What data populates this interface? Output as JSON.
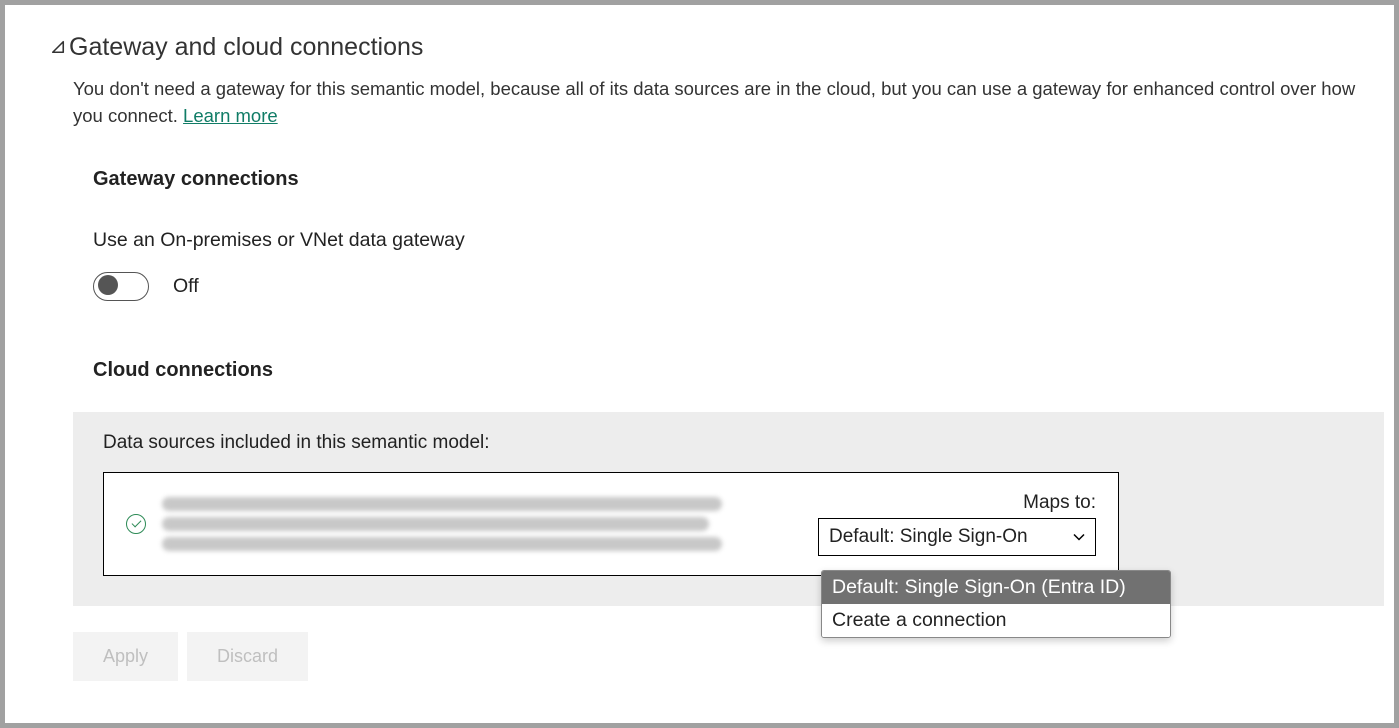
{
  "section": {
    "title": "Gateway and cloud connections",
    "description_pre": "You don't need a gateway for this semantic model, because all of its data sources are in the cloud, but you can use a gateway for enhanced control over how you connect. ",
    "learn_more": "Learn more"
  },
  "gateway": {
    "title": "Gateway connections",
    "toggle_label": "Use an On-premises or VNet data gateway",
    "toggle_state": "Off"
  },
  "cloud": {
    "title": "Cloud connections",
    "data_sources_label": "Data sources included in this semantic model:",
    "maps_to_label": "Maps to:",
    "dropdown_selected": "Default: Single Sign-On",
    "dropdown_options": {
      "opt1": "Default: Single Sign-On (Entra ID)",
      "opt2": "Create a connection"
    }
  },
  "buttons": {
    "apply": "Apply",
    "discard": "Discard"
  }
}
